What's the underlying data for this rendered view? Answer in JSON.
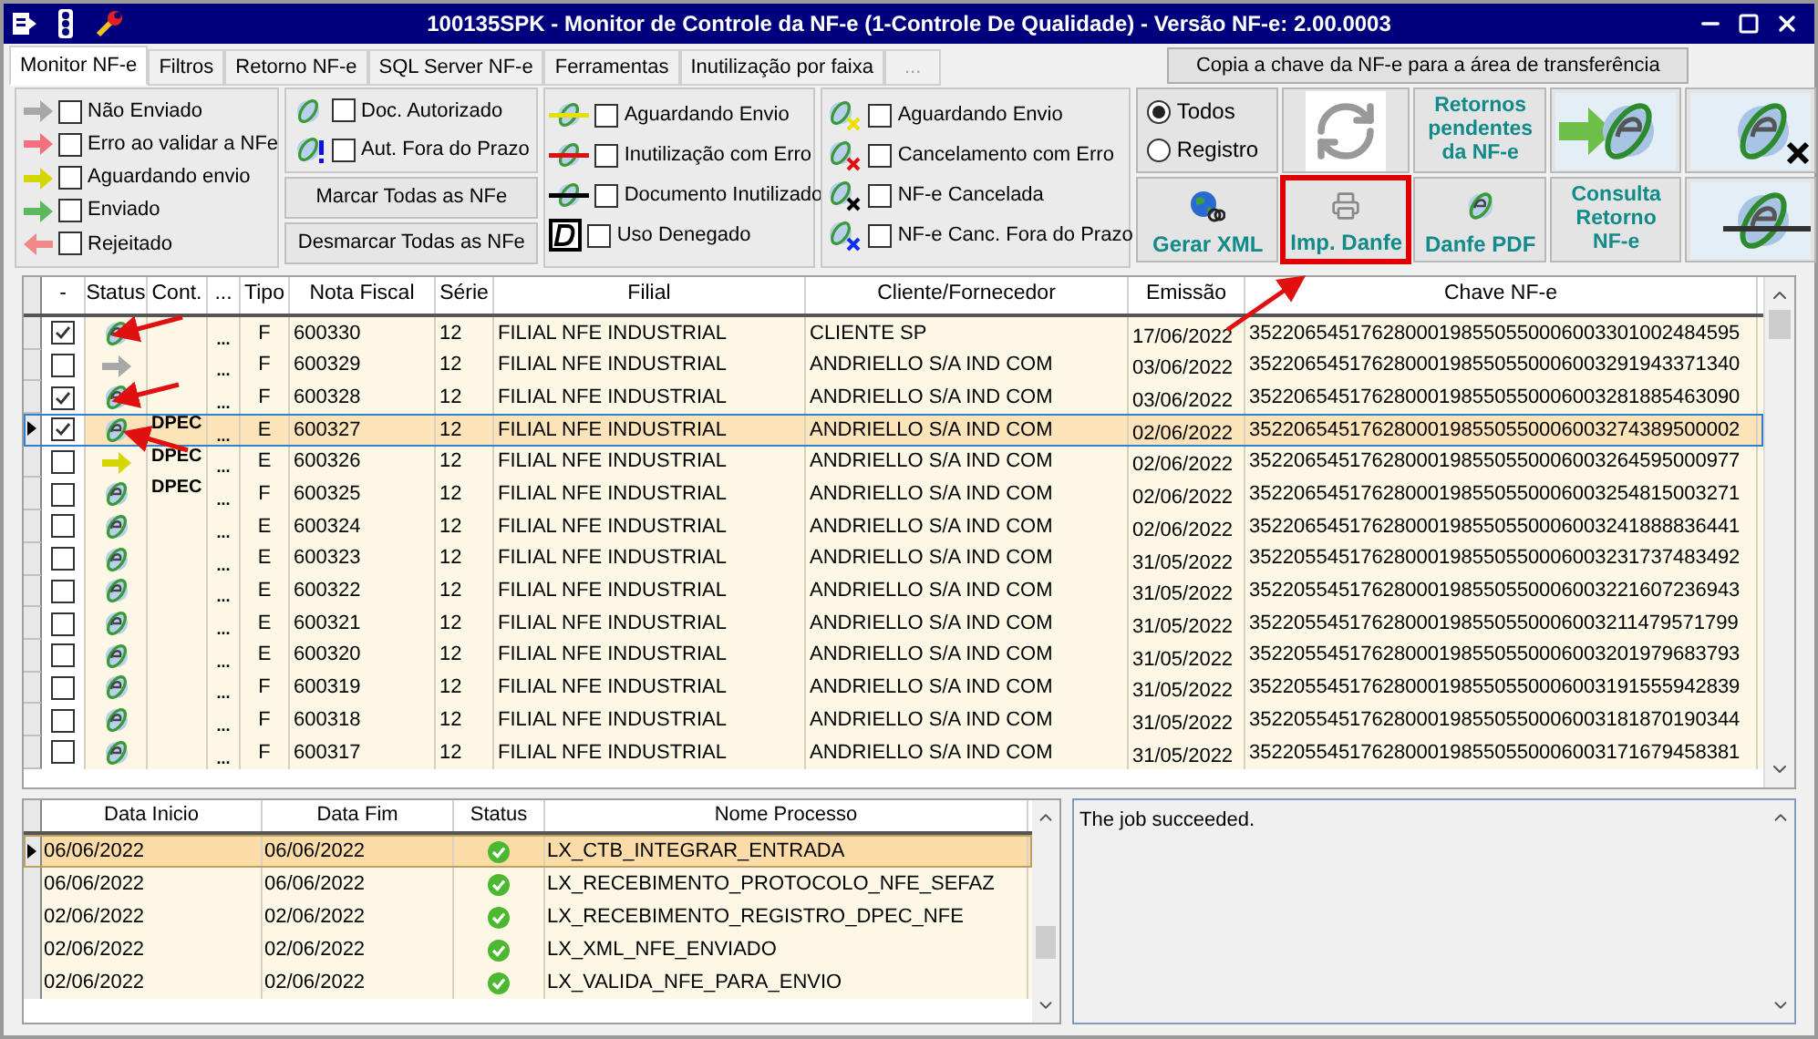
{
  "window": {
    "title": "100135SPK - Monitor de Controle da NF-e (1-Controle De Qualidade) - Versão NF-e: 2.00.0003"
  },
  "tabs": [
    {
      "label": "Monitor NF-e",
      "selected": true,
      "disabled": false
    },
    {
      "label": "Filtros",
      "selected": false,
      "disabled": false
    },
    {
      "label": "Retorno NF-e",
      "selected": false,
      "disabled": false
    },
    {
      "label": "SQL Server NF-e",
      "selected": false,
      "disabled": false
    },
    {
      "label": "Ferramentas",
      "selected": false,
      "disabled": false
    },
    {
      "label": "Inutilização por faixa",
      "selected": false,
      "disabled": false
    },
    {
      "label": "...",
      "selected": false,
      "disabled": true
    }
  ],
  "copy_button": "Copia a chave da NF-e para a área de transferência",
  "status_filters": [
    {
      "label": "Não Enviado",
      "checked": false,
      "kind": "gray"
    },
    {
      "label": "Erro ao validar a NFe",
      "checked": false,
      "kind": "pink"
    },
    {
      "label": "Aguardando envio",
      "checked": false,
      "kind": "yellow"
    },
    {
      "label": "Enviado",
      "checked": false,
      "kind": "green"
    },
    {
      "label": "Rejeitado",
      "checked": false,
      "kind": "back"
    }
  ],
  "doc_filters": [
    {
      "label": "Doc. Autorizado",
      "checked": false,
      "kind": "authorized"
    },
    {
      "label": "Aut. Fora do Prazo",
      "checked": false,
      "kind": "late"
    }
  ],
  "select_buttons": [
    "Marcar Todas as NFe",
    "Desmarcar Todas as NFe"
  ],
  "inutil_filters": [
    {
      "label": "Aguardando Envio",
      "checked": false,
      "kind": "yellow"
    },
    {
      "label": "Inutilização com Erro",
      "checked": false,
      "kind": "red"
    },
    {
      "label": "Documento Inutilizado",
      "checked": false,
      "kind": "black"
    },
    {
      "label": "Uso Denegado",
      "checked": false,
      "kind": "denied"
    }
  ],
  "cancel_filters": [
    {
      "label": "Aguardando Envio",
      "checked": false,
      "kind": "yellow"
    },
    {
      "label": "Cancelamento com Erro",
      "checked": false,
      "kind": "red"
    },
    {
      "label": "NF-e Cancelada",
      "checked": false,
      "kind": "black"
    },
    {
      "label": "NF-e Canc. Fora do Prazo",
      "checked": false,
      "kind": "blue"
    }
  ],
  "scope": [
    {
      "label": "Todos",
      "selected": true
    },
    {
      "label": "Registro",
      "selected": false
    }
  ],
  "actions": [
    {
      "kind": "refresh"
    },
    {
      "kind": "text",
      "label": "Retornos pendentes da NF-e"
    },
    {
      "kind": "send"
    },
    {
      "kind": "cancel"
    },
    {
      "kind": "globe",
      "label": "Gerar XML",
      "highlighted": false
    },
    {
      "kind": "printer",
      "label": "Imp. Danfe",
      "highlighted": true
    },
    {
      "kind": "nfe",
      "label": "Danfe PDF",
      "highlighted": false
    },
    {
      "kind": "text",
      "label": "Consulta Retorno NF-e"
    },
    {
      "kind": "void"
    }
  ],
  "table": {
    "columns": [
      "-",
      "Status",
      "Cont.",
      "...",
      "Tipo",
      "Nota Fiscal",
      "Série",
      "Filial",
      "Cliente/Fornecedor",
      "Emissão",
      "Chave NF-e"
    ],
    "rows": [
      {
        "checked": true,
        "selected": false,
        "kind": "nfe",
        "cont": "",
        "more": "...",
        "tipo": "F",
        "nota": "600330",
        "serie": "12",
        "filial": "FILIAL NFE INDUSTRIAL",
        "cliente": "CLIENTE SP",
        "emissao": "17/06/2022",
        "chave": "35220654517628000198550550006003301002484595"
      },
      {
        "checked": false,
        "selected": false,
        "kind": "gray_arrow",
        "cont": "",
        "more": "...",
        "tipo": "F",
        "nota": "600329",
        "serie": "12",
        "filial": "FILIAL NFE INDUSTRIAL",
        "cliente": "ANDRIELLO S/A IND COM",
        "emissao": "03/06/2022",
        "chave": "35220654517628000198550550006003291943371340"
      },
      {
        "checked": true,
        "selected": false,
        "kind": "nfe",
        "cont": "",
        "more": "...",
        "tipo": "F",
        "nota": "600328",
        "serie": "12",
        "filial": "FILIAL NFE INDUSTRIAL",
        "cliente": "ANDRIELLO S/A IND COM",
        "emissao": "03/06/2022",
        "chave": "35220654517628000198550550006003281885463090"
      },
      {
        "checked": true,
        "selected": true,
        "kind": "nfe",
        "cont": "DPEC",
        "more": "...",
        "tipo": "E",
        "nota": "600327",
        "serie": "12",
        "filial": "FILIAL NFE INDUSTRIAL",
        "cliente": "ANDRIELLO S/A IND COM",
        "emissao": "02/06/2022",
        "chave": "35220654517628000198550550006003274389500002"
      },
      {
        "checked": false,
        "selected": false,
        "kind": "yellow_arrow",
        "cont": "DPEC",
        "more": "...",
        "tipo": "E",
        "nota": "600326",
        "serie": "12",
        "filial": "FILIAL NFE INDUSTRIAL",
        "cliente": "ANDRIELLO S/A IND COM",
        "emissao": "02/06/2022",
        "chave": "35220654517628000198550550006003264595000977"
      },
      {
        "checked": false,
        "selected": false,
        "kind": "nfe",
        "cont": "DPEC",
        "more": "...",
        "tipo": "F",
        "nota": "600325",
        "serie": "12",
        "filial": "FILIAL NFE INDUSTRIAL",
        "cliente": "ANDRIELLO S/A IND COM",
        "emissao": "02/06/2022",
        "chave": "35220654517628000198550550006003254815003271"
      },
      {
        "checked": false,
        "selected": false,
        "kind": "nfe",
        "cont": "",
        "more": "...",
        "tipo": "E",
        "nota": "600324",
        "serie": "12",
        "filial": "FILIAL NFE INDUSTRIAL",
        "cliente": "ANDRIELLO S/A IND COM",
        "emissao": "02/06/2022",
        "chave": "35220654517628000198550550006003241888836441"
      },
      {
        "checked": false,
        "selected": false,
        "kind": "nfe",
        "cont": "",
        "more": "...",
        "tipo": "E",
        "nota": "600323",
        "serie": "12",
        "filial": "FILIAL NFE INDUSTRIAL",
        "cliente": "ANDRIELLO S/A IND COM",
        "emissao": "31/05/2022",
        "chave": "35220554517628000198550550006003231737483492"
      },
      {
        "checked": false,
        "selected": false,
        "kind": "nfe",
        "cont": "",
        "more": "...",
        "tipo": "E",
        "nota": "600322",
        "serie": "12",
        "filial": "FILIAL NFE INDUSTRIAL",
        "cliente": "ANDRIELLO S/A IND COM",
        "emissao": "31/05/2022",
        "chave": "35220554517628000198550550006003221607236943"
      },
      {
        "checked": false,
        "selected": false,
        "kind": "nfe",
        "cont": "",
        "more": "...",
        "tipo": "E",
        "nota": "600321",
        "serie": "12",
        "filial": "FILIAL NFE INDUSTRIAL",
        "cliente": "ANDRIELLO S/A IND COM",
        "emissao": "31/05/2022",
        "chave": "35220554517628000198550550006003211479571799"
      },
      {
        "checked": false,
        "selected": false,
        "kind": "nfe",
        "cont": "",
        "more": "...",
        "tipo": "E",
        "nota": "600320",
        "serie": "12",
        "filial": "FILIAL NFE INDUSTRIAL",
        "cliente": "ANDRIELLO S/A IND COM",
        "emissao": "31/05/2022",
        "chave": "35220554517628000198550550006003201979683793"
      },
      {
        "checked": false,
        "selected": false,
        "kind": "nfe",
        "cont": "",
        "more": "...",
        "tipo": "F",
        "nota": "600319",
        "serie": "12",
        "filial": "FILIAL NFE INDUSTRIAL",
        "cliente": "ANDRIELLO S/A IND COM",
        "emissao": "31/05/2022",
        "chave": "35220554517628000198550550006003191555942839"
      },
      {
        "checked": false,
        "selected": false,
        "kind": "nfe",
        "cont": "",
        "more": "...",
        "tipo": "F",
        "nota": "600318",
        "serie": "12",
        "filial": "FILIAL NFE INDUSTRIAL",
        "cliente": "ANDRIELLO S/A IND COM",
        "emissao": "31/05/2022",
        "chave": "35220554517628000198550550006003181870190344"
      },
      {
        "checked": false,
        "selected": false,
        "kind": "nfe",
        "cont": "",
        "more": "...",
        "tipo": "F",
        "nota": "600317",
        "serie": "12",
        "filial": "FILIAL NFE INDUSTRIAL",
        "cliente": "ANDRIELLO S/A IND COM",
        "emissao": "31/05/2022",
        "chave": "35220554517628000198550550006003171679458381"
      }
    ]
  },
  "jobs": {
    "columns": [
      "Data Inicio",
      "Data Fim",
      "Status",
      "Nome Processo"
    ],
    "rows": [
      {
        "selected": true,
        "start": "06/06/2022",
        "end": "06/06/2022",
        "kind": "ok",
        "name": "LX_CTB_INTEGRAR_ENTRADA"
      },
      {
        "selected": false,
        "start": "06/06/2022",
        "end": "06/06/2022",
        "kind": "ok",
        "name": "LX_RECEBIMENTO_PROTOCOLO_NFE_SEFAZ"
      },
      {
        "selected": false,
        "start": "02/06/2022",
        "end": "02/06/2022",
        "kind": "ok",
        "name": "LX_RECEBIMENTO_REGISTRO_DPEC_NFE"
      },
      {
        "selected": false,
        "start": "02/06/2022",
        "end": "02/06/2022",
        "kind": "ok",
        "name": "LX_XML_NFE_ENVIADO"
      },
      {
        "selected": false,
        "start": "02/06/2022",
        "end": "02/06/2022",
        "kind": "ok",
        "name": "LX_VALIDA_NFE_PARA_ENVIO"
      }
    ]
  },
  "log": "The job succeeded."
}
